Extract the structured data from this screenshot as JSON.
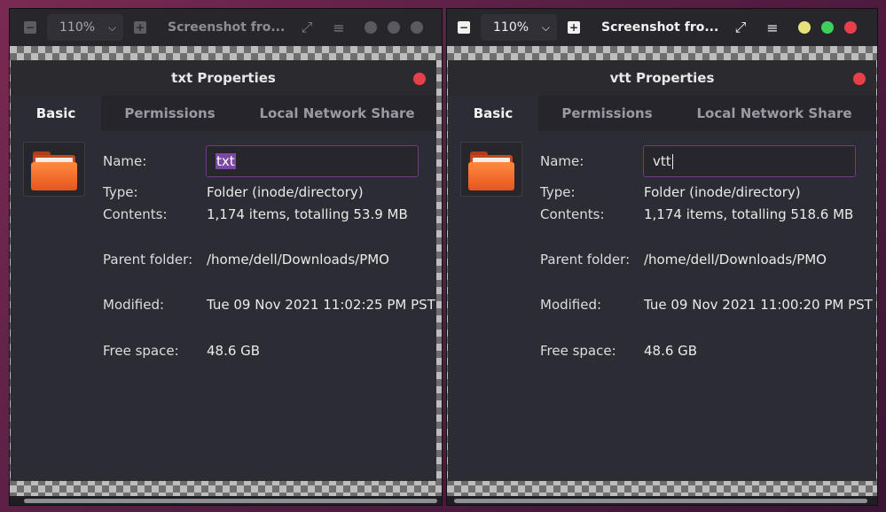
{
  "viewers": [
    {
      "zoom": "110%",
      "title": "Screenshot fro...",
      "dialog": {
        "title": "txt Properties",
        "tabs": [
          "Basic",
          "Permissions",
          "Local Network Share"
        ],
        "name_label": "Name:",
        "name_value": "txt",
        "type_label": "Type:",
        "type_value": "Folder (inode/directory)",
        "contents_label": "Contents:",
        "contents_value": "1,174 items, totalling 53.9 MB",
        "parent_label": "Parent folder:",
        "parent_value": "/home/dell/Downloads/PMO",
        "modified_label": "Modified:",
        "modified_value": "Tue 09 Nov 2021 11:02:25 PM PST",
        "free_label": "Free space:",
        "free_value": "48.6 GB"
      }
    },
    {
      "zoom": "110%",
      "title": "Screenshot fro...",
      "dialog": {
        "title": "vtt Properties",
        "tabs": [
          "Basic",
          "Permissions",
          "Local Network Share"
        ],
        "name_label": "Name:",
        "name_value": "vtt",
        "type_label": "Type:",
        "type_value": "Folder (inode/directory)",
        "contents_label": "Contents:",
        "contents_value": "1,174 items, totalling 518.6 MB",
        "parent_label": "Parent folder:",
        "parent_value": "/home/dell/Downloads/PMO",
        "modified_label": "Modified:",
        "modified_value": "Tue 09 Nov 2021 11:00:20 PM PST",
        "free_label": "Free space:",
        "free_value": "48.6 GB"
      }
    }
  ],
  "icons": {
    "zoom_out": "minus-square-icon",
    "zoom_in": "plus-square-icon",
    "fullscreen": "expand-icon",
    "menu": "hamburger-menu-icon",
    "folder": "folder-icon"
  },
  "colors": {
    "close": "#e8404a",
    "minimize": "#e8e07a",
    "maximize": "#3fcf5c",
    "inactive_dot": "#5a5a60",
    "selection": "#7b4aa0",
    "folder": "#e8541e"
  }
}
